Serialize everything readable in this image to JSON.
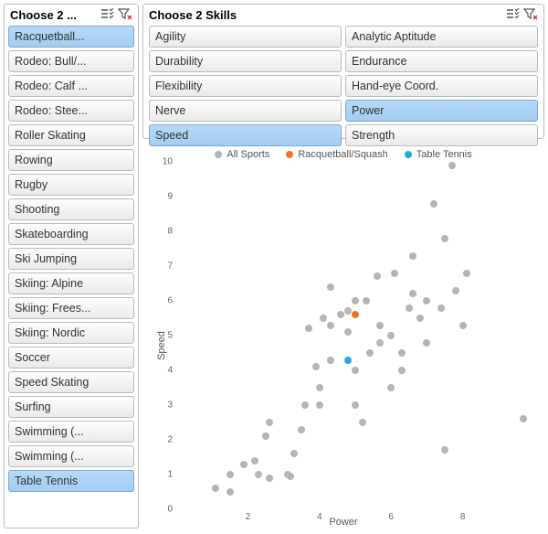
{
  "left": {
    "title": "Choose 2 ...",
    "items": [
      {
        "label": "Racquetball...",
        "selected": true
      },
      {
        "label": "Rodeo: Bull/...",
        "selected": false
      },
      {
        "label": "Rodeo: Calf ...",
        "selected": false
      },
      {
        "label": "Rodeo: Stee...",
        "selected": false
      },
      {
        "label": "Roller Skating",
        "selected": false
      },
      {
        "label": "Rowing",
        "selected": false
      },
      {
        "label": "Rugby",
        "selected": false
      },
      {
        "label": "Shooting",
        "selected": false
      },
      {
        "label": "Skateboarding",
        "selected": false
      },
      {
        "label": "Ski Jumping",
        "selected": false
      },
      {
        "label": "Skiing: Alpine",
        "selected": false
      },
      {
        "label": "Skiing: Frees...",
        "selected": false
      },
      {
        "label": "Skiing: Nordic",
        "selected": false
      },
      {
        "label": "Soccer",
        "selected": false
      },
      {
        "label": "Speed Skating",
        "selected": false
      },
      {
        "label": "Surfing",
        "selected": false
      },
      {
        "label": "Swimming (...",
        "selected": false
      },
      {
        "label": "Swimming (...",
        "selected": false
      },
      {
        "label": "Table Tennis",
        "selected": true
      }
    ]
  },
  "skills": {
    "title": "Choose 2 Skills",
    "items": [
      {
        "label": "Agility",
        "selected": false
      },
      {
        "label": "Analytic Aptitude",
        "selected": false
      },
      {
        "label": "Durability",
        "selected": false
      },
      {
        "label": "Endurance",
        "selected": false
      },
      {
        "label": "Flexibility",
        "selected": false
      },
      {
        "label": "Hand-eye Coord.",
        "selected": false
      },
      {
        "label": "Nerve",
        "selected": false
      },
      {
        "label": "Power",
        "selected": true
      },
      {
        "label": "Speed",
        "selected": true
      },
      {
        "label": "Strength",
        "selected": false
      }
    ]
  },
  "chart_data": {
    "type": "scatter",
    "xlabel": "Power",
    "ylabel": "Speed",
    "xlim": [
      0,
      10
    ],
    "ylim": [
      0,
      10
    ],
    "xticks": [
      2,
      4,
      6,
      8
    ],
    "yticks": [
      0,
      1,
      2,
      3,
      4,
      5,
      6,
      7,
      8,
      9,
      10
    ],
    "legend": [
      {
        "name": "All Sports",
        "color": "#b5b5b5"
      },
      {
        "name": "Racquetball/Squash",
        "color": "#e8762c"
      },
      {
        "name": "Table Tennis",
        "color": "#2aa7e0"
      }
    ],
    "series": [
      {
        "name": "All Sports",
        "color": "#b5b5b5",
        "points": [
          [
            1.1,
            0.6
          ],
          [
            1.5,
            0.5
          ],
          [
            1.5,
            1.0
          ],
          [
            1.9,
            1.3
          ],
          [
            2.2,
            1.4
          ],
          [
            2.3,
            1.0
          ],
          [
            2.6,
            0.9
          ],
          [
            2.5,
            2.1
          ],
          [
            2.6,
            2.5
          ],
          [
            3.1,
            1.0
          ],
          [
            3.2,
            0.95
          ],
          [
            3.3,
            1.6
          ],
          [
            3.5,
            2.3
          ],
          [
            3.6,
            3.0
          ],
          [
            3.7,
            5.2
          ],
          [
            3.9,
            4.1
          ],
          [
            4.0,
            3.0
          ],
          [
            4.0,
            3.5
          ],
          [
            4.1,
            5.5
          ],
          [
            4.3,
            4.3
          ],
          [
            4.3,
            5.3
          ],
          [
            4.3,
            6.4
          ],
          [
            4.6,
            5.6
          ],
          [
            4.8,
            5.1
          ],
          [
            4.8,
            5.7
          ],
          [
            5.0,
            4.0
          ],
          [
            5.0,
            3.0
          ],
          [
            5.0,
            6.0
          ],
          [
            5.2,
            2.5
          ],
          [
            5.3,
            6.0
          ],
          [
            5.4,
            4.5
          ],
          [
            5.6,
            6.7
          ],
          [
            5.7,
            4.8
          ],
          [
            5.7,
            5.3
          ],
          [
            6.0,
            3.5
          ],
          [
            6.0,
            5.0
          ],
          [
            6.1,
            6.8
          ],
          [
            6.3,
            4.0
          ],
          [
            6.3,
            4.5
          ],
          [
            6.5,
            5.8
          ],
          [
            6.6,
            6.2
          ],
          [
            6.6,
            7.3
          ],
          [
            6.8,
            5.5
          ],
          [
            7.0,
            4.8
          ],
          [
            7.0,
            6.0
          ],
          [
            7.2,
            8.8
          ],
          [
            7.4,
            5.8
          ],
          [
            7.5,
            7.8
          ],
          [
            7.5,
            1.7
          ],
          [
            7.7,
            9.9
          ],
          [
            7.8,
            6.3
          ],
          [
            8.0,
            5.3
          ],
          [
            8.1,
            6.8
          ],
          [
            9.7,
            2.6
          ]
        ]
      },
      {
        "name": "Racquetball/Squash",
        "color": "#e8762c",
        "points": [
          [
            5.0,
            5.6
          ]
        ]
      },
      {
        "name": "Table Tennis",
        "color": "#2aa7e0",
        "points": [
          [
            4.8,
            4.3
          ]
        ]
      }
    ]
  }
}
